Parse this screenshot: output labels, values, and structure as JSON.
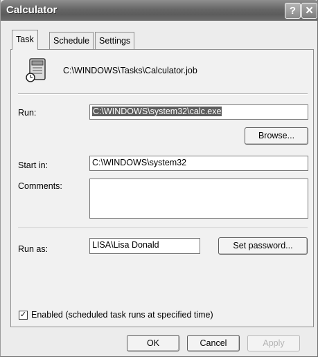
{
  "window": {
    "title": "Calculator",
    "help_glyph": "?",
    "close_glyph": "✕"
  },
  "tabs": [
    {
      "label": "Task"
    },
    {
      "label": "Schedule"
    },
    {
      "label": "Settings"
    }
  ],
  "task": {
    "path": "C:\\WINDOWS\\Tasks\\Calculator.job",
    "icon": "task-file-icon",
    "run_label": "Run:",
    "run_value": "C:\\WINDOWS\\system32\\calc.exe",
    "browse_label": "Browse...",
    "start_in_label": "Start in:",
    "start_in_value": "C:\\WINDOWS\\system32",
    "comments_label": "Comments:",
    "comments_value": "",
    "run_as_label": "Run as:",
    "run_as_value": "LISA\\Lisa Donald",
    "set_password_label": "Set password...",
    "enabled_label": "Enabled (scheduled task runs at specified time)",
    "enabled_checked": true
  },
  "buttons": {
    "ok": "OK",
    "cancel": "Cancel",
    "apply": "Apply"
  }
}
